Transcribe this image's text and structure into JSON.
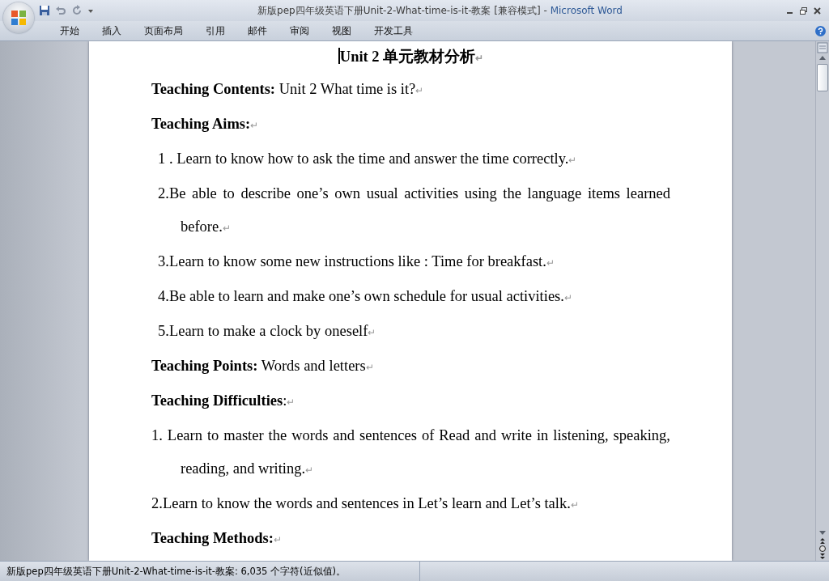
{
  "window": {
    "title": "新版pep四年级英语下册Unit-2-What-time-is-it-教案 [兼容模式]",
    "separator": "-",
    "app_name": "Microsoft Word"
  },
  "ribbon_tabs": [
    {
      "label": "开始",
      "selected": false
    },
    {
      "label": "插入",
      "selected": false
    },
    {
      "label": "页面布局",
      "selected": false
    },
    {
      "label": "引用",
      "selected": false
    },
    {
      "label": "邮件",
      "selected": false
    },
    {
      "label": "审阅",
      "selected": false
    },
    {
      "label": "视图",
      "selected": false
    },
    {
      "label": "开发工具",
      "selected": false
    }
  ],
  "document": {
    "paragraphs": [
      {
        "kind": "title",
        "text": "Unit 2 单元教材分析",
        "end_mark": "↵"
      },
      {
        "kind": "body",
        "text": "**Teaching Contents:** Unit 2 What time is it?",
        "end_mark": "↵"
      },
      {
        "kind": "body",
        "text": "**Teaching Aims:**",
        "end_mark": "↵"
      },
      {
        "kind": "item",
        "text": "1 . Learn to know how to ask the time and answer the time correctly.",
        "end_mark": "↵"
      },
      {
        "kind": "item",
        "text": "2.Be able to describe one’s own usual activities using the language items learned before.",
        "end_mark": "↵"
      },
      {
        "kind": "item",
        "text": "3.Learn to know some new instructions like : Time for breakfast.",
        "end_mark": "↵"
      },
      {
        "kind": "item",
        "text": "4.Be able to learn and make one’s own schedule for usual activities.",
        "end_mark": "↵"
      },
      {
        "kind": "item",
        "text": "5.Learn to make a clock by oneself",
        "end_mark": "↵"
      },
      {
        "kind": "body",
        "text": "**Teaching Points:** Words and letters",
        "end_mark": "↵"
      },
      {
        "kind": "body",
        "text": "**Teaching Difficulties**:",
        "end_mark": "↵"
      },
      {
        "kind": "hanging",
        "text": "1. Learn to master the words and sentences of Read and write in listening, speaking, reading, and writing.",
        "end_mark": "↵"
      },
      {
        "kind": "body",
        "text": "2.Learn to know the words and sentences in Let’s learn and Let’s talk.",
        "end_mark": "↵"
      },
      {
        "kind": "body",
        "text": "**Teaching Methods:**",
        "end_mark": "↵"
      }
    ]
  },
  "status_bar": {
    "text": "新版pep四年级英语下册Unit-2-What-time-is-it-教案: 6,035 个字符(近似值)。"
  }
}
